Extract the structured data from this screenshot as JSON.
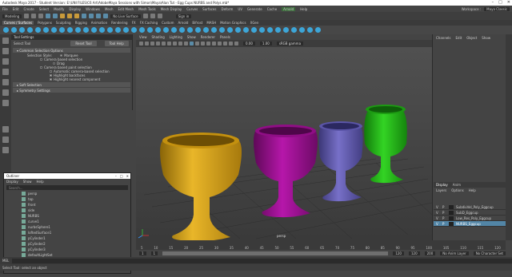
{
  "window": {
    "title": "Autodesk Maya 2017 - Student Version: E:\\UNI FILES\\C6 Art\\AdobeMaya Sessions with Simon\\Maya\\Alan Tut - Egg Cups NURBS and Polys.mb*"
  },
  "menu": {
    "items": [
      "File",
      "Edit",
      "Create",
      "Select",
      "Modify",
      "Display",
      "Windows",
      "Mesh",
      "Edit Mesh",
      "Mesh Tools",
      "Mesh Display",
      "Curves",
      "Surfaces",
      "Deform",
      "UV",
      "Generate",
      "Cache",
      "Arnold",
      "Help"
    ],
    "workspace_label": "Workspace :",
    "workspace_value": "Maya Classic"
  },
  "status_line": {
    "mode": "Modeling",
    "no_live": "No Live Surface",
    "sign_in": "Sign in"
  },
  "shelf_tabs": [
    "Curves / Surfaces",
    "Polygons",
    "Sculpting",
    "Rigging",
    "Animation",
    "Rendering",
    "FX",
    "FX Caching",
    "Custom",
    "Arnold",
    "Bifrost",
    "MASH",
    "Motion Graphics",
    "XGen"
  ],
  "tool_settings": {
    "panel_title": "Tool Settings",
    "tool_name": "Select Tool",
    "reset_label": "Reset Tool",
    "help_label": "Tool Help",
    "section_common": "Common Selection Options",
    "selection_style_label": "Selection Style:",
    "options": [
      "Marquee",
      "Camera based selection",
      "Drag",
      "Camera based paint selection",
      "Automatic camera-based selection",
      "Highlight backfaces",
      "Highlight nearest component"
    ],
    "section_soft": "Soft Selection",
    "section_symmetry": "Symmetry Settings"
  },
  "viewport": {
    "menus": [
      "View",
      "Shading",
      "Lighting",
      "Show",
      "Renderer",
      "Panels"
    ],
    "gamma": "sRGB gamma",
    "val1": "0.00",
    "val2": "1.00",
    "camera_label": "persp",
    "colors": {
      "yellow": "#e0a91a",
      "magenta": "#a8119c",
      "blue": "#6a63b8",
      "green": "#27c21a"
    }
  },
  "channel_box": {
    "tabs": [
      "Channels",
      "Edit",
      "Object",
      "Show"
    ]
  },
  "layers": {
    "tabs": [
      "Display",
      "Anim"
    ],
    "menus": [
      "Layers",
      "Options",
      "Help"
    ],
    "items": [
      {
        "v": "V",
        "p": "P",
        "name": "SubdivVel_Poly_Eggcup"
      },
      {
        "v": "V",
        "p": "P",
        "name": "SubD_Eggcup"
      },
      {
        "v": "V",
        "p": "P",
        "name": "Low_Res_Poly_Eggcup"
      },
      {
        "v": "V",
        "p": "P",
        "name": "NURBS_Eggcup"
      }
    ]
  },
  "outliner": {
    "title": "Outliner",
    "menus": [
      "Display",
      "Show",
      "Help"
    ],
    "search_placeholder": "Search...",
    "items": [
      "persp",
      "top",
      "front",
      "side",
      "NURBS",
      "curve1",
      "nurbsSphere1",
      "loftedSurface1",
      "pCylinder1",
      "pCylinder2",
      "pCylinder3",
      "defaultLightSet",
      "defaultObjectSet"
    ]
  },
  "timeline": {
    "ticks": [
      "5",
      "10",
      "15",
      "20",
      "25",
      "30",
      "35",
      "40",
      "45",
      "50",
      "55",
      "60",
      "65",
      "70",
      "75",
      "80",
      "85",
      "90",
      "95",
      "100",
      "105",
      "110",
      "115",
      "120"
    ]
  },
  "range": {
    "start": "1",
    "start2": "1",
    "end": "120",
    "end2": "120",
    "end3": "200",
    "no_anim_layer": "No Anim Layer",
    "no_char_set": "No Character Set"
  },
  "cmd": {
    "label": "MEL"
  },
  "help": {
    "text": "Select Tool: select an object"
  }
}
